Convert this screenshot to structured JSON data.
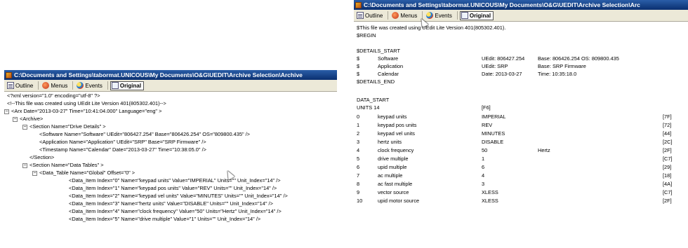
{
  "left": {
    "title": "C:\\Documents and Settings\\tabormat.UNICOUS\\My Documents\\O&G\\UEDIT\\Archive Selection\\Archive",
    "toolbar": {
      "outline": "Outline",
      "menus": "Menus",
      "events": "Events",
      "original": "Original"
    },
    "lines": [
      "<?xml version=\"1.0\" encoding=\"utf-8\" ?>",
      "<!--This file was created using UEdit Lite Version 401(805302.401)-->",
      "<Arx Date=\"2013-03-27\" Time=\"10:41:04.000\" Language=\"eng\" >",
      "<Archive>",
      "<Section Name=\"Drive Details\" >",
      "<Software Name=\"Software\" UEdit=\"806427.254\" Base=\"806426.254\" OS=\"809800.435\" />",
      "<Application Name=\"Application\" UEdit=\"SRP\" Base=\"SRP Firmware\" />",
      "<Timestamp Name=\"Calendar\" Date=\"2013-03-27\" Time=\"10:38:05.0\" />",
      "</Section>",
      "<Section Name=\"Data Tables\" >",
      "<Data_Table Name=\"Global\" Offset=\"0\" >",
      "<Data_Item Index=\"0\" Name=\"keypad units\" Value=\"IMPERIAL\" Units=\"\" Unit_Index=\"14\" />",
      "<Data_Item Index=\"1\" Name=\"keypad pos units\" Value=\"REV\" Units=\"\" Unit_Index=\"14\" />",
      "<Data_Item Index=\"2\" Name=\"keypad vel units\" Value=\"MINUTES\" Units=\"\" Unit_Index=\"14\" />",
      "<Data_Item Index=\"3\" Name=\"hertz units\" Value=\"DISABLE\" Units=\"\" Unit_Index=\"14\" />",
      "<Data_Item Index=\"4\" Name=\"clock frequency\" Value=\"50\" Units=\"Hertz\" Unit_Index=\"14\" />",
      "<Data_Item Index=\"5\" Name=\"drive multiple\" Value=\"1\" Units=\"\" Unit_Index=\"14\" />"
    ]
  },
  "right": {
    "title": "C:\\Documents and Settings\\tabormat.UNICOUS\\My Documents\\O&G\\UEDIT\\Archive Selection\\Arc",
    "toolbar": {
      "outline": "Outline",
      "menus": "Menus",
      "events": "Events",
      "original": "Original"
    },
    "header_lines": [
      "$This file was created using UEdit Lite Version 401(805302.401).",
      "$REGIN"
    ],
    "details_start": "$DETAILS_START",
    "details": [
      [
        "$",
        "Software",
        "UEdit: 806427.254",
        "Base: 806426.254  OS: 809800.435"
      ],
      [
        "$",
        "Application",
        "UEdit: SRP",
        "Base: SRP Firmware"
      ],
      [
        "$",
        "Calendar",
        "Date: 2013-03-27",
        "Time: 10:35:18.0"
      ]
    ],
    "details_end": "$DETAILS_END",
    "data_start": "DATA_START",
    "units_row": [
      "UNITS 14",
      "[F6]"
    ],
    "data_rows": [
      [
        "0",
        "keypad units",
        "IMPERIAL",
        "",
        "[7F]"
      ],
      [
        "1",
        "keypad pos units",
        "REV",
        "",
        "[72]"
      ],
      [
        "2",
        "keypad vel units",
        "MINUTES",
        "",
        "[44]"
      ],
      [
        "3",
        "hertz units",
        "DISABLE",
        "",
        "[2C]"
      ],
      [
        "4",
        "clock frequency",
        "50",
        "Hertz",
        "[2F]"
      ],
      [
        "5",
        "drive multiple",
        "1",
        "",
        "[C7]"
      ],
      [
        "6",
        "upid multiple",
        "6",
        "",
        "[29]"
      ],
      [
        "7",
        "ac multiple",
        "4",
        "",
        "[18]"
      ],
      [
        "8",
        "ac fast multiple",
        "3",
        "",
        "[4A]"
      ],
      [
        "9",
        "vector source",
        "XLESS",
        "",
        "[C7]"
      ],
      [
        "10",
        "upid motor source",
        "XLESS",
        "",
        "[2F]"
      ]
    ]
  }
}
